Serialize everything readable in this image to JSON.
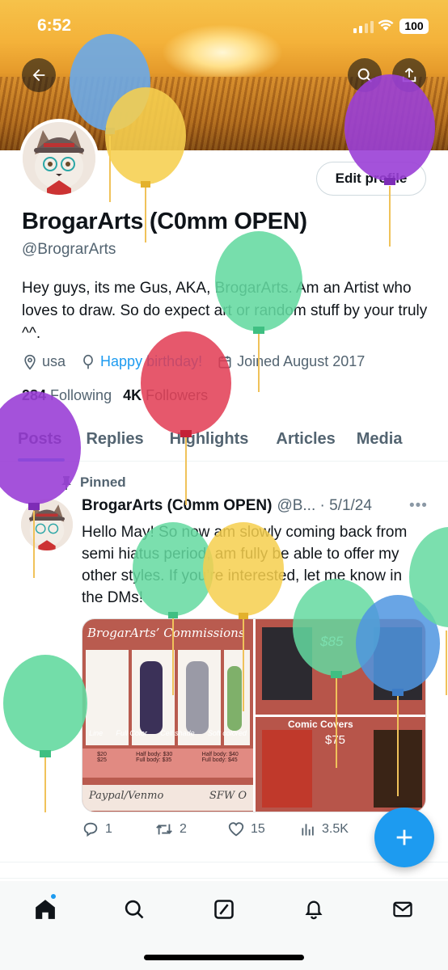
{
  "status_bar": {
    "time": "6:52",
    "battery": "100"
  },
  "profile": {
    "display_name": "BrogarArts (C0mm OPEN)",
    "handle": "@BrograrArts",
    "bio": "Hey guys, its me Gus, AKA, BrogarArts. Am an Artist who loves to draw. So do expect art or random stuff by your truly ^^.",
    "location": "usa",
    "birthday": "Happy birthday!",
    "joined": "Joined August 2017",
    "following_count": "284",
    "following_label": "Following",
    "followers_count": "4K",
    "followers_label": "Followers",
    "edit_button": "Edit profile"
  },
  "tabs": [
    {
      "label": "Posts",
      "active": true
    },
    {
      "label": "Replies"
    },
    {
      "label": "Highlights"
    },
    {
      "label": "Articles"
    },
    {
      "label": "Media"
    }
  ],
  "post": {
    "pinned_label": "Pinned",
    "author": "BrogarArts (C0mm OPEN)",
    "handle_date": "@B... · 5/1/24",
    "text": "Hello May! So now am slowly coming back from semi hiatus period, am fully be able to offer my other styles. If you’re interested, let me know in the DMs!",
    "media": {
      "left_title": "BrogarArts’ Commissions",
      "left_labels": [
        "Line",
        "Full Color",
        "Cell shade",
        "Soft colored"
      ],
      "left_prices": [
        "$20",
        "$25",
        "Half body: $30",
        "Full body: $35",
        "Half body: $40",
        "Full body: $45"
      ],
      "left_footer": "Paypal/Venmo",
      "left_sfw": "SFW O",
      "right_top_price": "$85",
      "right_bottom_title": "Comic Covers",
      "right_bottom_price": "$75"
    },
    "replies": "1",
    "reposts": "2",
    "likes": "15",
    "views": "3.5K"
  },
  "colors": {
    "accent": "#1d9bf0",
    "text": "#0f1419",
    "muted": "#536471"
  },
  "icons": [
    "back-arrow-icon",
    "search-icon",
    "share-icon",
    "location-icon",
    "balloon-icon",
    "calendar-icon",
    "pin-icon",
    "reply-icon",
    "repost-icon",
    "like-icon",
    "views-icon",
    "compose-plus-icon",
    "home-icon",
    "explore-icon",
    "grok-icon",
    "notifications-icon",
    "messages-icon"
  ]
}
